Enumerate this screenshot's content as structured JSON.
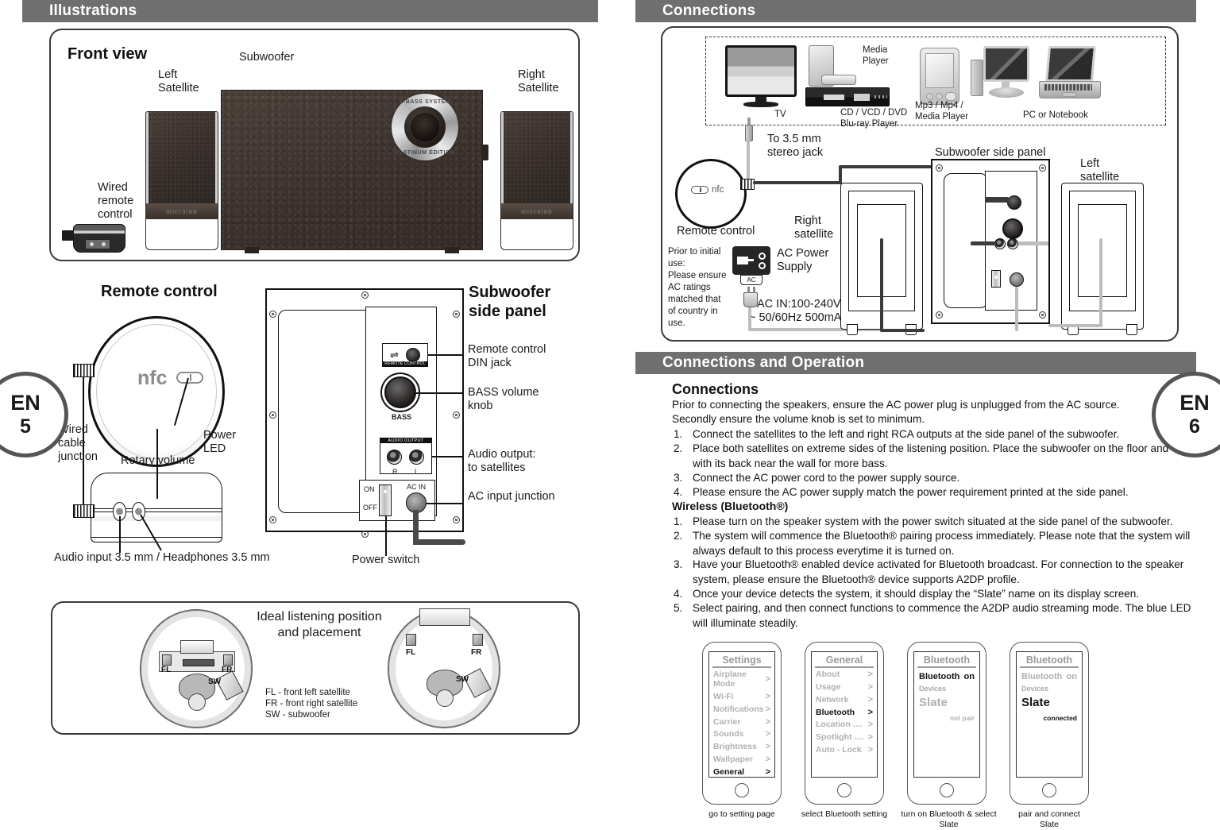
{
  "sections": {
    "illustrations": "Illustrations",
    "connections": "Connections",
    "connections_and_operation": "Connections and Operation"
  },
  "page_markers": [
    {
      "lang": "EN",
      "number": "5"
    },
    {
      "lang": "EN",
      "number": "6"
    }
  ],
  "front_view": {
    "title": "Front view",
    "subwoofer_label": "Subwoofer",
    "left_satellite_label": "Left\nSatellite",
    "right_satellite_label": "Right\nSatellite",
    "wired_remote_label": "Wired\nremote\ncontrol",
    "badge_top": "X-BASS SYSTEM",
    "badge_bottom": "PLATINUM EDITION",
    "brand": "microlab"
  },
  "remote_control": {
    "title": "Remote control",
    "nfc_text": "nfc",
    "labels": {
      "wired_cable_junction": "Wired\ncable\njunction",
      "rotary_volume": "Rotary volume",
      "power_led": "Power\nLED",
      "audio_input": "Audio input 3.5 mm / Headphones 3.5 mm"
    }
  },
  "side_panel": {
    "title": "Subwoofer\nside panel",
    "callouts": {
      "din_jack": "Remote control\nDIN jack",
      "bass_knob": "BASS volume\nknob",
      "audio_output": "Audio output:\nto satellites",
      "ac_input": "AC input junction",
      "power_switch": "Power switch"
    },
    "silk": {
      "remote_control": "REMOTE CONTROL",
      "bass": "BASS",
      "audio_output": "AUDIO OUTPUT",
      "r": "R",
      "l": "L",
      "on": "ON",
      "off": "OFF",
      "ac_in": "AC IN"
    }
  },
  "listening": {
    "title": "Ideal listening position\nand placement",
    "legend": [
      "FL - front left satellite",
      "FR - front right satellite",
      "SW - subwoofer"
    ],
    "markers": {
      "fl": "FL",
      "fr": "FR",
      "sw": "SW"
    }
  },
  "sources": {
    "tv": "TV",
    "media_player": "Media\nPlayer",
    "disc_player": "CD / VCD / DVD\nBlu-ray Player",
    "mp3": "Mp3 / Mp4 /\nMedia Player",
    "pc": "PC or Notebook"
  },
  "conn_diagram": {
    "stereo_jack": "To 3.5 mm\nstereo jack",
    "remote_control": "Remote control",
    "nfc_text": "nfc",
    "right_satellite": "Right\nsatellite",
    "left_satellite": "Left\nsatellite",
    "subwoofer_side_panel": "Subwoofer side panel",
    "ac_power_supply": "AC Power\nSupply",
    "ac_label": "AC",
    "ac_rating_line1": "AC IN:100-240V",
    "ac_rating_line2": "~ 50/60Hz 500mA",
    "prior_note": "Prior to initial\nuse:\nPlease ensure\nAC ratings\nmatched that\nof  country in\nuse."
  },
  "operation": {
    "heading": "Connections",
    "intro_line1": "Prior to connecting the speakers, ensure the AC power plug is unplugged from the AC source.",
    "intro_line2": "Secondly ensure the volume knob is set to minimum.",
    "steps": [
      "Connect the satellites to the left and right RCA outputs at the side panel of the subwoofer.",
      "Place both satellites on extreme sides of the listening position. Place the subwoofer on the floor and with its back near the wall for more bass.",
      "Connect the AC power cord to the power supply source.",
      "Please ensure the AC power supply match the power requirement printed at the side panel."
    ],
    "wireless_heading": "Wireless (Bluetooth®)",
    "wireless_steps": [
      "Please turn on the speaker system with the power switch situated at the side panel of the subwoofer.",
      "The system will commence the Bluetooth® pairing process immediately. Please note that the system will always default to this process everytime it is turned on.",
      "Have your Bluetooth® enabled device activated for Bluetooth broadcast.  For connection to the speaker system, please ensure the Bluetooth® device supports A2DP profile.",
      "Once your device detects the system, it should display the “Slate” name on its display screen.",
      "Select pairing, and then connect functions to commence the A2DP audio streaming mode. The blue LED will illuminate steadily."
    ]
  },
  "phones": [
    {
      "caption": "go to setting page",
      "title": "Settings",
      "rows": [
        {
          "label": "Airplane Mode",
          "chev": ">",
          "active": false
        },
        {
          "label": "Wi-Fi",
          "chev": ">",
          "active": false
        },
        {
          "label": "Notifications",
          "chev": ">",
          "active": false
        },
        {
          "label": "Carrier",
          "chev": ">",
          "active": false
        },
        {
          "label": "Sounds",
          "chev": ">",
          "active": false
        },
        {
          "label": "Brightness",
          "chev": ">",
          "active": false
        },
        {
          "label": "Wallpaper",
          "chev": ">",
          "active": false
        },
        {
          "label": "General",
          "chev": ">",
          "active": true
        }
      ]
    },
    {
      "caption": "select Bluetooth setting",
      "title": "General",
      "rows": [
        {
          "label": "About",
          "chev": ">",
          "active": false
        },
        {
          "label": "Usage",
          "chev": ">",
          "active": false
        },
        {
          "label": "Network",
          "chev": ">",
          "active": false
        },
        {
          "label": "Bluetooth",
          "chev": ">",
          "active": true
        },
        {
          "label": "Location ....",
          "chev": ">",
          "active": false
        },
        {
          "label": "Spotlight ....",
          "chev": ">",
          "active": false
        },
        {
          "label": "Auto - Lock",
          "chev": ">",
          "active": false
        }
      ]
    },
    {
      "caption": "turn on Bluetooth & select\nSlate",
      "title": "Bluetooth",
      "toggle_label": "Bluetooth",
      "toggle_value": "on",
      "toggle_active": true,
      "devices_label": "Devices",
      "device_name": "Slate",
      "device_active": false,
      "status": "not pair",
      "status_active": true
    },
    {
      "caption": "pair and connect\nSlate",
      "title": "Bluetooth",
      "toggle_label": "Bluetooth",
      "toggle_value": "on",
      "toggle_active": false,
      "devices_label": "Devices",
      "device_name": "Slate",
      "device_active": true,
      "status": "connected",
      "status_active": true
    }
  ],
  "colors": {
    "header_bar": "#6f6f6f",
    "ink": "#1a1a1a",
    "muted": "#b0b0b0"
  }
}
